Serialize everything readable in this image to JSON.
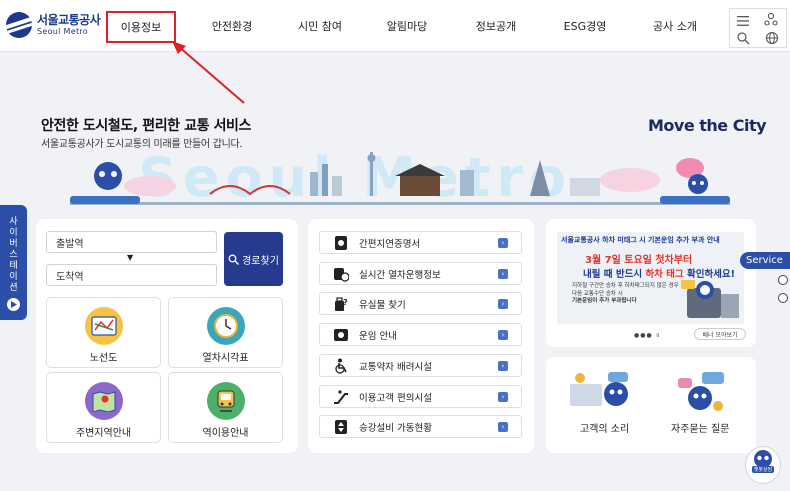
{
  "header": {
    "logo_ko": "서울교통공사",
    "logo_en": "Seoul Metro",
    "nav": [
      "이용정보",
      "안전환경",
      "시민 참여",
      "알림마당",
      "정보공개",
      "ESG경영",
      "공사 소개"
    ],
    "highlight_color": "#e01f26"
  },
  "hero": {
    "title": "안전한 도시철도, 편리한 교통 서비스",
    "subtitle": "서울교통공사가 도시교통의 미래를 만들어 갑니다.",
    "slogan": "Move the City",
    "art_text": "Seoul Metro"
  },
  "side_tab": {
    "label_chars": [
      "사",
      "이",
      "버",
      "스",
      "테",
      "이",
      "션"
    ]
  },
  "route": {
    "departure": "출발역",
    "arrival": "도착역",
    "search_label": "경로찾기"
  },
  "tiles": [
    {
      "label": "노선도",
      "icon": "route-map-icon",
      "color": "#f6c343"
    },
    {
      "label": "열차시각표",
      "icon": "clock-icon",
      "color": "#3aa6b9"
    },
    {
      "label": "주변지역안내",
      "icon": "area-map-icon",
      "color": "#8b68c9"
    },
    {
      "label": "역이용안내",
      "icon": "station-icon",
      "color": "#4db06a"
    }
  ],
  "services": [
    {
      "label": "간편지연증명서",
      "icon": "certificate-icon"
    },
    {
      "label": "실시간 열차운행정보",
      "icon": "train-clock-icon"
    },
    {
      "label": "유실물 찾기",
      "icon": "lost-item-icon"
    },
    {
      "label": "운임 안내",
      "icon": "fare-icon"
    },
    {
      "label": "교통약자 배려시설",
      "icon": "wheelchair-icon"
    },
    {
      "label": "이용고객 편의시설",
      "icon": "escalator-icon"
    },
    {
      "label": "승강설비 가동현황",
      "icon": "elevator-icon"
    }
  ],
  "banner": {
    "top": "서울교통공사 하차 미태그 시 기본운임 추가 부과 안내",
    "line1": "3월 7일 토요일 첫차부터",
    "line2_a": "내릴 때 반드시 ",
    "line2_b": "하차 태그",
    "line2_c": " 확인하세요!",
    "small1": "지하철 구간만 승차 후 하차태그되지 않은 경우",
    "small2": "다음 교통수단 승차 시",
    "small3": "기본운임이 추가 부과됩니다",
    "more": "배너 모아보기",
    "dots": "●●● ॥"
  },
  "quick": [
    {
      "label": "고객의 소리",
      "icon": "customer-voice-icon"
    },
    {
      "label": "자주묻는 질문",
      "icon": "faq-icon"
    }
  ],
  "service_pill": "Service",
  "chatbot": "챗봇상담"
}
